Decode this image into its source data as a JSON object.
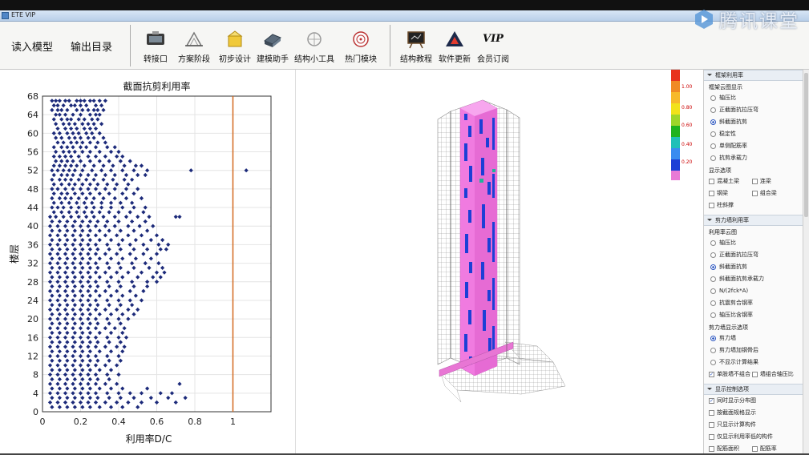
{
  "window": {
    "title": "ETE VIP"
  },
  "watermark": {
    "text": "腾讯课堂"
  },
  "toolbar": {
    "read_model": "读入模型",
    "output_dir": "输出目录",
    "buttons": [
      {
        "id": "convert",
        "label": "转接口",
        "icon": "convert-icon"
      },
      {
        "id": "scheme",
        "label": "方案阶段",
        "icon": "scheme-icon"
      },
      {
        "id": "prelim",
        "label": "初步设计",
        "icon": "preliminary-design-icon"
      },
      {
        "id": "modeling",
        "label": "建模助手",
        "icon": "modeling-assistant-icon"
      },
      {
        "id": "tools",
        "label": "结构小工具",
        "icon": "structure-tools-icon"
      },
      {
        "id": "hot",
        "label": "热门模块",
        "icon": "hot-modules-icon"
      },
      {
        "id": "tutorial",
        "label": "结构教程",
        "icon": "tutorial-icon"
      },
      {
        "id": "update",
        "label": "软件更新",
        "icon": "software-update-icon"
      },
      {
        "id": "vip",
        "label": "会员订阅",
        "icon": "vip-icon",
        "icon_text": "VIP"
      }
    ]
  },
  "chart_data": {
    "type": "scatter",
    "title": "截面抗剪利用率",
    "xlabel": "利用率D/C",
    "ylabel": "楼层",
    "xlim": [
      0,
      1.2
    ],
    "ylim": [
      0,
      68
    ],
    "xticks": [
      "0",
      "0.2",
      "0.4",
      "0.6",
      "0.8",
      "1"
    ],
    "yticks": [
      "0",
      "4",
      "8",
      "12",
      "16",
      "20",
      "24",
      "28",
      "32",
      "36",
      "40",
      "44",
      "48",
      "52",
      "56",
      "60",
      "64",
      "68"
    ],
    "limit_line": {
      "x": 1.0,
      "color": "#d2691e"
    },
    "grid": true,
    "marker_color": "#1c2a7a",
    "points_per_floor_note": "",
    "floors": [
      {
        "y": 67,
        "x": [
          0.05,
          0.07,
          0.09,
          0.12,
          0.14,
          0.18,
          0.2,
          0.22,
          0.25,
          0.27,
          0.3,
          0.33
        ]
      },
      {
        "y": 66,
        "x": [
          0.06,
          0.08,
          0.11,
          0.15,
          0.17,
          0.2,
          0.23,
          0.28,
          0.31
        ]
      },
      {
        "y": 65,
        "x": [
          0.05,
          0.08,
          0.1,
          0.13,
          0.18,
          0.21,
          0.24,
          0.27,
          0.29,
          0.32
        ]
      },
      {
        "y": 64,
        "x": [
          0.07,
          0.09,
          0.12,
          0.16,
          0.2,
          0.25,
          0.28,
          0.3
        ]
      },
      {
        "y": 63,
        "x": [
          0.06,
          0.1,
          0.13,
          0.15,
          0.19,
          0.22,
          0.26,
          0.29
        ]
      },
      {
        "y": 62,
        "x": [
          0.07,
          0.11,
          0.14,
          0.17,
          0.21,
          0.24,
          0.27,
          0.31
        ]
      },
      {
        "y": 61,
        "x": [
          0.08,
          0.12,
          0.15,
          0.18,
          0.22,
          0.25,
          0.28
        ]
      },
      {
        "y": 60,
        "x": [
          0.06,
          0.09,
          0.13,
          0.16,
          0.19,
          0.23,
          0.26,
          0.3
        ]
      },
      {
        "y": 59,
        "x": [
          0.07,
          0.1,
          0.14,
          0.17,
          0.2,
          0.24,
          0.27,
          0.32
        ]
      },
      {
        "y": 58,
        "x": [
          0.08,
          0.11,
          0.15,
          0.18,
          0.21,
          0.25,
          0.29,
          0.33
        ]
      },
      {
        "y": 57,
        "x": [
          0.06,
          0.1,
          0.13,
          0.16,
          0.2,
          0.23,
          0.28,
          0.34,
          0.38
        ]
      },
      {
        "y": 56,
        "x": [
          0.07,
          0.11,
          0.14,
          0.17,
          0.21,
          0.25,
          0.3,
          0.36,
          0.4
        ]
      },
      {
        "y": 55,
        "x": [
          0.06,
          0.09,
          0.12,
          0.15,
          0.19,
          0.24,
          0.28,
          0.33,
          0.39,
          0.42
        ]
      },
      {
        "y": 54,
        "x": [
          0.07,
          0.1,
          0.13,
          0.16,
          0.2,
          0.25,
          0.3,
          0.35,
          0.41,
          0.46
        ]
      },
      {
        "y": 53,
        "x": [
          0.06,
          0.09,
          0.12,
          0.15,
          0.18,
          0.22,
          0.27,
          0.32,
          0.37,
          0.43,
          0.49,
          0.52
        ]
      },
      {
        "y": 52,
        "x": [
          0.05,
          0.08,
          0.11,
          0.14,
          0.17,
          0.21,
          0.26,
          0.31,
          0.36,
          0.42,
          0.48,
          0.55,
          0.78,
          1.07
        ]
      },
      {
        "y": 51,
        "x": [
          0.06,
          0.1,
          0.13,
          0.16,
          0.2,
          0.24,
          0.28,
          0.33,
          0.38,
          0.44,
          0.5,
          0.54
        ]
      },
      {
        "y": 50,
        "x": [
          0.05,
          0.09,
          0.12,
          0.15,
          0.19,
          0.23,
          0.27,
          0.32,
          0.37,
          0.43,
          0.47
        ]
      },
      {
        "y": 49,
        "x": [
          0.06,
          0.1,
          0.14,
          0.17,
          0.21,
          0.25,
          0.29,
          0.34,
          0.39,
          0.45
        ]
      },
      {
        "y": 48,
        "x": [
          0.05,
          0.08,
          0.12,
          0.16,
          0.2,
          0.24,
          0.28,
          0.33,
          0.38,
          0.44,
          0.5
        ]
      },
      {
        "y": 47,
        "x": [
          0.06,
          0.1,
          0.13,
          0.17,
          0.21,
          0.25,
          0.3,
          0.35,
          0.42,
          0.48
        ]
      },
      {
        "y": 46,
        "x": [
          0.05,
          0.09,
          0.12,
          0.15,
          0.19,
          0.23,
          0.27,
          0.32,
          0.38,
          0.44,
          0.52
        ]
      },
      {
        "y": 45,
        "x": [
          0.06,
          0.1,
          0.14,
          0.18,
          0.22,
          0.26,
          0.31,
          0.36,
          0.41,
          0.47
        ]
      },
      {
        "y": 44,
        "x": [
          0.05,
          0.08,
          0.11,
          0.15,
          0.19,
          0.23,
          0.27,
          0.31,
          0.36,
          0.42,
          0.48,
          0.54
        ]
      },
      {
        "y": 43,
        "x": [
          0.06,
          0.1,
          0.14,
          0.18,
          0.22,
          0.26,
          0.3,
          0.35,
          0.4,
          0.46,
          0.53
        ]
      },
      {
        "y": 42,
        "x": [
          0.04,
          0.07,
          0.11,
          0.15,
          0.19,
          0.23,
          0.27,
          0.32,
          0.38,
          0.44,
          0.5,
          0.56,
          0.7,
          0.72
        ]
      },
      {
        "y": 41,
        "x": [
          0.05,
          0.09,
          0.13,
          0.17,
          0.21,
          0.25,
          0.29,
          0.34,
          0.4,
          0.47,
          0.54
        ]
      },
      {
        "y": 40,
        "x": [
          0.04,
          0.08,
          0.12,
          0.16,
          0.2,
          0.24,
          0.28,
          0.33,
          0.38,
          0.45,
          0.51,
          0.58
        ]
      },
      {
        "y": 39,
        "x": [
          0.05,
          0.09,
          0.13,
          0.17,
          0.21,
          0.25,
          0.3,
          0.35,
          0.41,
          0.48,
          0.55
        ]
      },
      {
        "y": 38,
        "x": [
          0.04,
          0.08,
          0.12,
          0.16,
          0.2,
          0.24,
          0.28,
          0.33,
          0.39,
          0.45,
          0.52,
          0.6
        ]
      },
      {
        "y": 37,
        "x": [
          0.05,
          0.09,
          0.13,
          0.17,
          0.21,
          0.25,
          0.3,
          0.36,
          0.42,
          0.49,
          0.57,
          0.63
        ]
      },
      {
        "y": 36,
        "x": [
          0.04,
          0.08,
          0.12,
          0.16,
          0.2,
          0.24,
          0.28,
          0.34,
          0.4,
          0.46,
          0.53,
          0.61,
          0.66
        ]
      },
      {
        "y": 35,
        "x": [
          0.05,
          0.09,
          0.13,
          0.17,
          0.21,
          0.25,
          0.29,
          0.35,
          0.41,
          0.48,
          0.55,
          0.62,
          0.65
        ]
      },
      {
        "y": 34,
        "x": [
          0.04,
          0.08,
          0.12,
          0.16,
          0.2,
          0.24,
          0.28,
          0.33,
          0.39,
          0.46,
          0.53,
          0.6
        ]
      },
      {
        "y": 33,
        "x": [
          0.05,
          0.09,
          0.13,
          0.17,
          0.21,
          0.25,
          0.3,
          0.36,
          0.42,
          0.49,
          0.57
        ]
      },
      {
        "y": 32,
        "x": [
          0.04,
          0.08,
          0.12,
          0.16,
          0.2,
          0.24,
          0.28,
          0.34,
          0.4,
          0.47,
          0.54,
          0.61
        ]
      },
      {
        "y": 31,
        "x": [
          0.05,
          0.09,
          0.13,
          0.17,
          0.21,
          0.25,
          0.29,
          0.35,
          0.41,
          0.48,
          0.56,
          0.63
        ]
      },
      {
        "y": 30,
        "x": [
          0.04,
          0.08,
          0.12,
          0.16,
          0.2,
          0.24,
          0.28,
          0.33,
          0.39,
          0.45,
          0.52,
          0.6,
          0.64
        ]
      },
      {
        "y": 29,
        "x": [
          0.05,
          0.09,
          0.13,
          0.17,
          0.21,
          0.25,
          0.3,
          0.36,
          0.42,
          0.5,
          0.58,
          0.62
        ]
      },
      {
        "y": 28,
        "x": [
          0.04,
          0.08,
          0.12,
          0.16,
          0.2,
          0.24,
          0.28,
          0.34,
          0.4,
          0.47,
          0.55,
          0.6
        ]
      },
      {
        "y": 27,
        "x": [
          0.05,
          0.09,
          0.13,
          0.17,
          0.21,
          0.25,
          0.29,
          0.35,
          0.41,
          0.48,
          0.55
        ]
      },
      {
        "y": 26,
        "x": [
          0.04,
          0.08,
          0.12,
          0.16,
          0.2,
          0.24,
          0.28,
          0.33,
          0.39,
          0.46,
          0.53
        ]
      },
      {
        "y": 25,
        "x": [
          0.05,
          0.09,
          0.13,
          0.17,
          0.21,
          0.25,
          0.3,
          0.36,
          0.42,
          0.49
        ]
      },
      {
        "y": 24,
        "x": [
          0.04,
          0.08,
          0.12,
          0.16,
          0.2,
          0.24,
          0.28,
          0.34,
          0.4,
          0.46,
          0.52
        ]
      },
      {
        "y": 23,
        "x": [
          0.05,
          0.09,
          0.13,
          0.17,
          0.21,
          0.25,
          0.29,
          0.35,
          0.41,
          0.47
        ]
      },
      {
        "y": 22,
        "x": [
          0.04,
          0.08,
          0.12,
          0.16,
          0.2,
          0.24,
          0.28,
          0.33,
          0.39,
          0.45,
          0.5
        ]
      },
      {
        "y": 21,
        "x": [
          0.05,
          0.09,
          0.13,
          0.17,
          0.21,
          0.25,
          0.3,
          0.36,
          0.42,
          0.48
        ]
      },
      {
        "y": 20,
        "x": [
          0.04,
          0.08,
          0.12,
          0.16,
          0.2,
          0.24,
          0.28,
          0.34,
          0.4,
          0.45
        ]
      },
      {
        "y": 19,
        "x": [
          0.05,
          0.09,
          0.13,
          0.17,
          0.21,
          0.25,
          0.29,
          0.35,
          0.41
        ]
      },
      {
        "y": 18,
        "x": [
          0.04,
          0.08,
          0.12,
          0.16,
          0.2,
          0.24,
          0.28,
          0.33,
          0.38,
          0.43
        ]
      },
      {
        "y": 17,
        "x": [
          0.05,
          0.09,
          0.13,
          0.17,
          0.21,
          0.25,
          0.3,
          0.36,
          0.42
        ]
      },
      {
        "y": 16,
        "x": [
          0.04,
          0.08,
          0.12,
          0.16,
          0.2,
          0.24,
          0.28,
          0.34,
          0.4,
          0.44
        ]
      },
      {
        "y": 15,
        "x": [
          0.05,
          0.09,
          0.13,
          0.17,
          0.21,
          0.25,
          0.29,
          0.35,
          0.41
        ]
      },
      {
        "y": 14,
        "x": [
          0.04,
          0.08,
          0.12,
          0.16,
          0.2,
          0.24,
          0.28,
          0.33,
          0.39,
          0.43
        ]
      },
      {
        "y": 13,
        "x": [
          0.05,
          0.09,
          0.13,
          0.17,
          0.21,
          0.25,
          0.3,
          0.36,
          0.42
        ]
      },
      {
        "y": 12,
        "x": [
          0.04,
          0.08,
          0.12,
          0.16,
          0.2,
          0.24,
          0.28,
          0.34,
          0.4
        ]
      },
      {
        "y": 11,
        "x": [
          0.05,
          0.09,
          0.13,
          0.17,
          0.21,
          0.25,
          0.29,
          0.35,
          0.41
        ]
      },
      {
        "y": 10,
        "x": [
          0.04,
          0.08,
          0.12,
          0.16,
          0.2,
          0.24,
          0.28,
          0.33,
          0.39
        ]
      },
      {
        "y": 9,
        "x": [
          0.05,
          0.09,
          0.13,
          0.17,
          0.21,
          0.25,
          0.3,
          0.36
        ]
      },
      {
        "y": 8,
        "x": [
          0.04,
          0.08,
          0.12,
          0.16,
          0.2,
          0.24,
          0.28,
          0.34,
          0.4
        ]
      },
      {
        "y": 7,
        "x": [
          0.05,
          0.09,
          0.13,
          0.17,
          0.21,
          0.25,
          0.29,
          0.35
        ]
      },
      {
        "y": 6,
        "x": [
          0.04,
          0.08,
          0.12,
          0.16,
          0.2,
          0.24,
          0.28,
          0.33,
          0.39,
          0.72
        ]
      },
      {
        "y": 5,
        "x": [
          0.05,
          0.09,
          0.13,
          0.17,
          0.21,
          0.25,
          0.3,
          0.36,
          0.42,
          0.55
        ]
      },
      {
        "y": 4,
        "x": [
          0.04,
          0.08,
          0.12,
          0.16,
          0.2,
          0.24,
          0.28,
          0.34,
          0.4,
          0.46,
          0.52,
          0.62,
          0.68
        ]
      },
      {
        "y": 3,
        "x": [
          0.05,
          0.09,
          0.13,
          0.17,
          0.21,
          0.25,
          0.29,
          0.35,
          0.41,
          0.48,
          0.57,
          0.66,
          0.75
        ]
      },
      {
        "y": 2,
        "x": [
          0.04,
          0.08,
          0.12,
          0.16,
          0.2,
          0.24,
          0.28,
          0.33,
          0.39,
          0.45,
          0.52,
          0.6,
          0.7
        ]
      },
      {
        "y": 1,
        "x": [
          0.05,
          0.09,
          0.13,
          0.17,
          0.21,
          0.25,
          0.3,
          0.36,
          0.42,
          0.5
        ]
      }
    ]
  },
  "legend": {
    "items": [
      {
        "label": "1.00",
        "color": "#e8331c"
      },
      {
        "label": "0.80",
        "color": "#f2e21a"
      },
      {
        "label": "0.60",
        "color": "#1fb31f"
      },
      {
        "label": "0.40",
        "color": "#1c3fd6"
      },
      {
        "label": "0.20",
        "color": "#e87ad6"
      }
    ]
  },
  "side_panel": {
    "frame_section": "框架利用率",
    "frame_cloud_group": "框架云图显示",
    "frame_radios": [
      {
        "label": "轴压比",
        "on": false
      },
      {
        "label": "正截面抗拉压弯",
        "on": false
      },
      {
        "label": "斜截面抗剪",
        "on": true
      },
      {
        "label": "稳定性",
        "on": false
      },
      {
        "label": "单侧配筋率",
        "on": false
      },
      {
        "label": "抗剪承载力",
        "on": false
      }
    ],
    "display_group": "显示选项",
    "display_checks": [
      {
        "label": "混凝土梁",
        "on": false
      },
      {
        "label": "连梁",
        "on": false
      },
      {
        "label": "钢梁",
        "on": false
      },
      {
        "label": "组合梁",
        "on": false
      },
      {
        "label": "柱斜撑",
        "on": false
      }
    ],
    "wall_section": "剪力墙利用率",
    "wall_cloud_group": "利用率云图",
    "wall_radios": [
      {
        "label": "轴压比",
        "on": false
      },
      {
        "label": "正截面抗拉压弯",
        "on": false
      },
      {
        "label": "斜截面抗剪",
        "on": true
      },
      {
        "label": "斜截面抗剪承载力",
        "on": false
      },
      {
        "label": "N/(2fck*A)",
        "on": false
      },
      {
        "label": "抗震剪合钢率",
        "on": false
      },
      {
        "label": "轴压比含钢率",
        "on": false
      }
    ],
    "wall_display_group": "剪力墙显示选项",
    "wall_display_radios": [
      {
        "label": "剪力墙",
        "on": true
      },
      {
        "label": "剪力墙加钢骨后",
        "on": false
      },
      {
        "label": "不显示计算结果",
        "on": false
      }
    ],
    "combine_checks": [
      {
        "label": "单肢墙不组合",
        "on": true
      },
      {
        "label": "墙组合轴压比",
        "on": false
      }
    ],
    "control_section": "显示控制选项",
    "control_checks": [
      {
        "label": "同时显示分布图",
        "on": true
      },
      {
        "label": "按截面规格显示",
        "on": false
      },
      {
        "label": "只显示计算构件",
        "on": false
      },
      {
        "label": "仅显示利用率低的构件",
        "on": false
      }
    ],
    "bottom_checks": [
      {
        "label": "配筋面积",
        "on": false
      },
      {
        "label": "配筋率",
        "on": false
      },
      {
        "label": "按次梁配筋",
        "on": false
      },
      {
        "label": "按次柱配筋",
        "on": false
      }
    ]
  }
}
